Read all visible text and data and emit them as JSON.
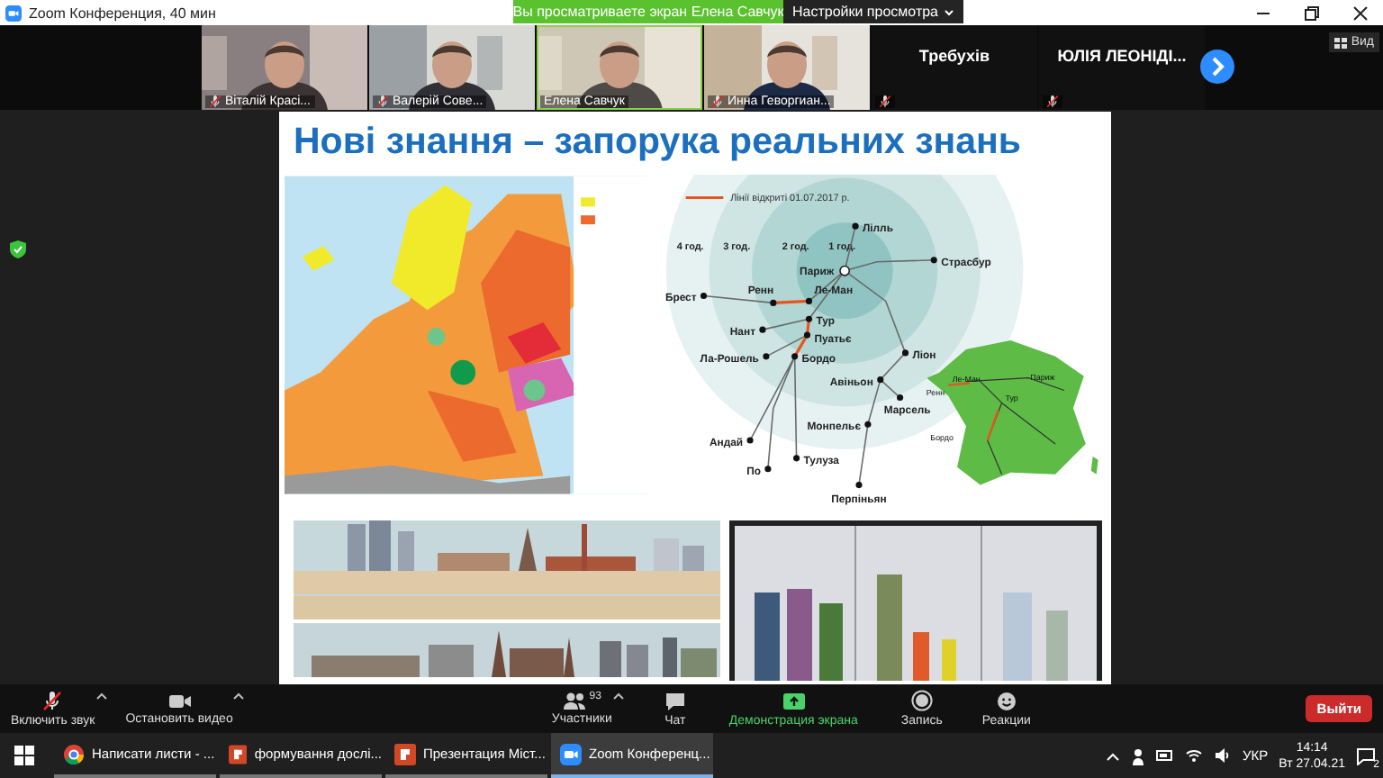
{
  "window": {
    "title": "Zoom Конференция, 40 мин"
  },
  "share_banner": {
    "text": "Вы просматриваете экран Елена Савчук",
    "view_options": "Настройки просмотра"
  },
  "video_strip": {
    "participants": [
      {
        "name": "Віталій Красі...",
        "kind": "video",
        "muted": true,
        "speaking": false
      },
      {
        "name": "Валерій Сове...",
        "kind": "video",
        "muted": true,
        "speaking": false
      },
      {
        "name": "Елена Савчук",
        "kind": "video",
        "muted": false,
        "speaking": true
      },
      {
        "name": "Инна Геворгиан...",
        "kind": "video",
        "muted": true,
        "speaking": false
      },
      {
        "name": "Требухів",
        "kind": "name",
        "muted": true,
        "speaking": false
      },
      {
        "name": "ЮЛІЯ ЛЕОНІДІ...",
        "kind": "name",
        "muted": true,
        "speaking": false
      }
    ],
    "view_button": "Вид"
  },
  "slide": {
    "title": "Нові знання – запорука реальних знань",
    "rail_map": {
      "legend": "Лінії відкриті 01.07.2017 р.",
      "rings": [
        "4 год.",
        "3 год.",
        "2 год.",
        "1 год."
      ],
      "cities": [
        "Лілль",
        "Париж",
        "Страсбур",
        "Брест",
        "Ренн",
        "Ле-Ман",
        "Тур",
        "Пуатьє",
        "Нант",
        "Ла-Рошель",
        "Бордо",
        "Ліон",
        "Авіньон",
        "Марсель",
        "Монпельє",
        "Андай",
        "По",
        "Тулуза",
        "Перпіньян"
      ],
      "france_labels": [
        "Ле-Ман",
        "Париж",
        "Ренн",
        "Тур",
        "Бордо"
      ]
    }
  },
  "toolbar": {
    "audio": {
      "label": "Включить звук",
      "muted": true
    },
    "video": {
      "label": "Остановить видео"
    },
    "participants": {
      "label": "Участники",
      "count": "93"
    },
    "chat": "Чат",
    "share": "Демонстрация экрана",
    "record": "Запись",
    "reactions": "Реакции",
    "leave": "Выйти"
  },
  "taskbar": {
    "apps": [
      {
        "label": "Написати листи - ...",
        "kind": "chrome",
        "selected": false
      },
      {
        "label": "формування дослі...",
        "kind": "powerpoint",
        "selected": false
      },
      {
        "label": "Презентация Міст...",
        "kind": "powerpoint",
        "selected": false
      },
      {
        "label": "Zoom Конференц...",
        "kind": "zoom",
        "selected": true
      }
    ],
    "language": "УКР",
    "time": "14:14",
    "date": "Вт 27.04.21",
    "notifications": "2"
  }
}
